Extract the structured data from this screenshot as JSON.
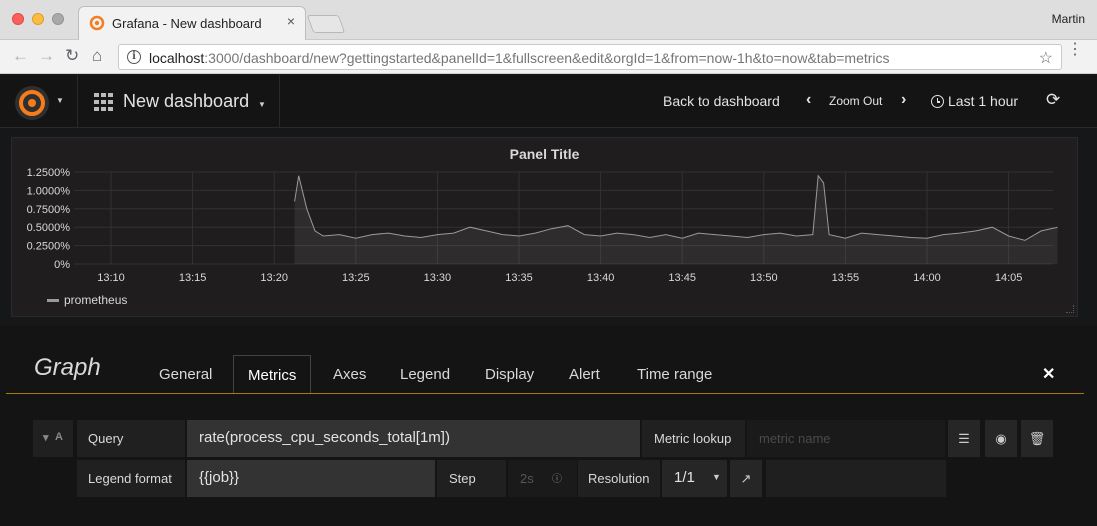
{
  "browser": {
    "tab_title": "Grafana - New dashboard",
    "tab_close": "×",
    "profile": "Martin",
    "url_host": "localhost",
    "url_rest": ":3000/dashboard/new?gettingstarted&panelId=1&fullscreen&edit&orgId=1&from=now-1h&to=now&tab=metrics",
    "icons": {
      "back": "back-arrow-icon",
      "forward": "forward-arrow-icon",
      "reload": "reload-icon",
      "home": "home-icon",
      "info": "info-icon",
      "star": "star-icon",
      "menu": "menu-icon"
    }
  },
  "navbar": {
    "dashboard_title": "New dashboard",
    "back_to_dashboard": "Back to dashboard",
    "zoom_out": "Zoom Out",
    "time_range": "Last 1 hour"
  },
  "panel": {
    "title": "Panel Title",
    "legend": [
      {
        "name": "prometheus",
        "color": "#9a9a9a"
      }
    ]
  },
  "chart_data": {
    "type": "line",
    "title": "Panel Title",
    "xlabel": "",
    "ylabel": "",
    "x_ticks": [
      "13:10",
      "13:15",
      "13:20",
      "13:25",
      "13:30",
      "13:35",
      "13:40",
      "13:45",
      "13:50",
      "13:55",
      "14:00",
      "14:05"
    ],
    "y_ticks": [
      "0%",
      "0.2500%",
      "0.5000%",
      "0.7500%",
      "1.0000%",
      "1.2500%"
    ],
    "ylim": [
      0,
      1.25
    ],
    "y_unit": "%",
    "grid": true,
    "legend_position": "bottom-left",
    "series": [
      {
        "name": "prometheus",
        "color": "#9a9a9a",
        "x": [
          "13:21:15",
          "13:21:30",
          "13:22:00",
          "13:22:30",
          "13:23:00",
          "13:24:00",
          "13:25:00",
          "13:26:00",
          "13:27:00",
          "13:28:00",
          "13:29:00",
          "13:30:00",
          "13:31:00",
          "13:32:00",
          "13:33:00",
          "13:34:00",
          "13:35:00",
          "13:36:00",
          "13:37:00",
          "13:38:00",
          "13:39:00",
          "13:40:00",
          "13:41:00",
          "13:42:00",
          "13:43:00",
          "13:44:00",
          "13:45:00",
          "13:46:00",
          "13:47:00",
          "13:48:00",
          "13:49:00",
          "13:50:00",
          "13:51:00",
          "13:52:00",
          "13:53:00",
          "13:53:20",
          "13:53:40",
          "13:54:00",
          "13:55:00",
          "13:56:00",
          "13:57:00",
          "13:58:00",
          "13:59:00",
          "14:00:00",
          "14:01:00",
          "14:02:00",
          "14:03:00",
          "14:04:00",
          "14:05:00",
          "14:06:00",
          "14:07:00",
          "14:08:00"
        ],
        "values": [
          0.85,
          1.2,
          0.75,
          0.45,
          0.38,
          0.4,
          0.35,
          0.4,
          0.42,
          0.38,
          0.36,
          0.4,
          0.42,
          0.5,
          0.45,
          0.4,
          0.38,
          0.42,
          0.48,
          0.52,
          0.4,
          0.38,
          0.42,
          0.4,
          0.36,
          0.4,
          0.35,
          0.42,
          0.4,
          0.38,
          0.36,
          0.4,
          0.42,
          0.38,
          0.4,
          1.2,
          1.1,
          0.4,
          0.35,
          0.42,
          0.4,
          0.38,
          0.36,
          0.35,
          0.4,
          0.42,
          0.45,
          0.5,
          0.38,
          0.32,
          0.45,
          0.5
        ]
      }
    ]
  },
  "editor": {
    "title": "Graph",
    "tabs": [
      "General",
      "Metrics",
      "Axes",
      "Legend",
      "Display",
      "Alert",
      "Time range"
    ],
    "active_tab": "Metrics",
    "query_row_id": "A",
    "query_label": "Query",
    "query_value": "rate(process_cpu_seconds_total[1m])",
    "metric_lookup_label": "Metric lookup",
    "metric_lookup_placeholder": "metric name",
    "legend_format_label": "Legend format",
    "legend_format_value": "{{job}}",
    "step_label": "Step",
    "step_placeholder": "2s",
    "resolution_label": "Resolution",
    "resolution_value": "1/1"
  }
}
